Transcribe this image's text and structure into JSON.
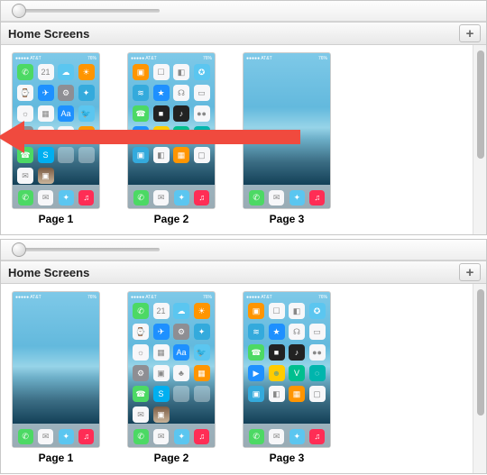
{
  "sections": [
    {
      "title": "Home Screens",
      "pages": [
        {
          "label": "Page 1",
          "layout": "full5",
          "position": 1
        },
        {
          "label": "Page 2",
          "layout": "full5b",
          "position": 2
        },
        {
          "label": "Page 3",
          "layout": "empty",
          "position": 3
        }
      ],
      "arrow": true
    },
    {
      "title": "Home Screens",
      "pages": [
        {
          "label": "Page 1",
          "layout": "empty",
          "position": 1
        },
        {
          "label": "Page 2",
          "layout": "full5",
          "position": 2
        },
        {
          "label": "Page 3",
          "layout": "full5b",
          "position": 3
        }
      ],
      "arrow": false
    }
  ],
  "status": {
    "left": "●●●●● AT&T",
    "right": "76%"
  },
  "dock": [
    {
      "cls": "c-green",
      "glyph": "✆"
    },
    {
      "cls": "c-white",
      "glyph": "✉"
    },
    {
      "cls": "c-lblue",
      "glyph": "✦"
    },
    {
      "cls": "c-pink",
      "glyph": "♫"
    }
  ],
  "layouts": {
    "full5": [
      [
        "c-green",
        "✆"
      ],
      [
        "c-white",
        "21"
      ],
      [
        "c-lblue",
        "☁"
      ],
      [
        "c-orange",
        "☀"
      ],
      [
        "c-white",
        "⌚"
      ],
      [
        "c-blue",
        "✈"
      ],
      [
        "c-gray",
        "⚙"
      ],
      [
        "c-cyan",
        "✦"
      ],
      [
        "c-white",
        "☼"
      ],
      [
        "c-white",
        "▦"
      ],
      [
        "c-blue",
        "Aa"
      ],
      [
        "c-lblue",
        "🐦"
      ],
      [
        "c-gray",
        "⚙"
      ],
      [
        "c-white",
        "▣"
      ],
      [
        "c-white",
        "♣"
      ],
      [
        "c-orange",
        "▦"
      ],
      [
        "c-green",
        "☎"
      ],
      [
        "c-skype",
        "S"
      ],
      [
        "c-folder",
        " "
      ],
      [
        "c-folder",
        " "
      ],
      [
        "c-white",
        "✉"
      ],
      [
        "c-insta",
        "▣"
      ]
    ],
    "full5b": [
      [
        "c-orange",
        "▣"
      ],
      [
        "c-white",
        "☐"
      ],
      [
        "c-white",
        "◧"
      ],
      [
        "c-lblue",
        "✪"
      ],
      [
        "c-cyan",
        "≋"
      ],
      [
        "c-blue",
        "★"
      ],
      [
        "c-white",
        "☊"
      ],
      [
        "c-white",
        "▭"
      ],
      [
        "c-green",
        "☎"
      ],
      [
        "c-dark",
        "■"
      ],
      [
        "c-dark",
        "♪"
      ],
      [
        "c-white",
        "●●"
      ],
      [
        "c-blue",
        "▶"
      ],
      [
        "c-yellow",
        "☻"
      ],
      [
        "c-vine",
        "V"
      ],
      [
        "c-teal",
        "◌"
      ],
      [
        "c-cyan",
        "▣"
      ],
      [
        "c-white",
        "◧"
      ],
      [
        "c-orange",
        "▦"
      ],
      [
        "c-white",
        "▢"
      ]
    ],
    "empty": []
  },
  "plus": "+"
}
